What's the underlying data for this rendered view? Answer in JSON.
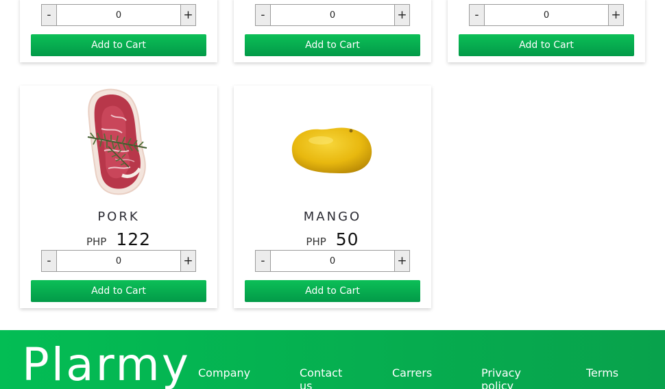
{
  "top_cards": [
    {
      "quantity": "0",
      "minus_label": "-",
      "plus_label": "+",
      "cart_label": "Add to Cart"
    },
    {
      "quantity": "0",
      "minus_label": "-",
      "plus_label": "+",
      "cart_label": "Add to Cart"
    },
    {
      "quantity": "0",
      "minus_label": "-",
      "plus_label": "+",
      "cart_label": "Add to Cart"
    }
  ],
  "products": [
    {
      "name": "PORK",
      "currency": "PHP",
      "price": "122",
      "quantity": "0",
      "minus_label": "-",
      "plus_label": "+",
      "cart_label": "Add to Cart",
      "image": "pork-steak-image"
    },
    {
      "name": "MANGO",
      "currency": "PHP",
      "price": "50",
      "quantity": "0",
      "minus_label": "-",
      "plus_label": "+",
      "cart_label": "Add to Cart",
      "image": "mango-image"
    }
  ],
  "footer": {
    "brand": "Plarmy",
    "links": [
      "Company",
      "Contact us",
      "Carrers",
      "Privacy policy",
      "Terms"
    ]
  },
  "colors": {
    "accent_green": "#03bd54",
    "button_green": "#029a48"
  }
}
